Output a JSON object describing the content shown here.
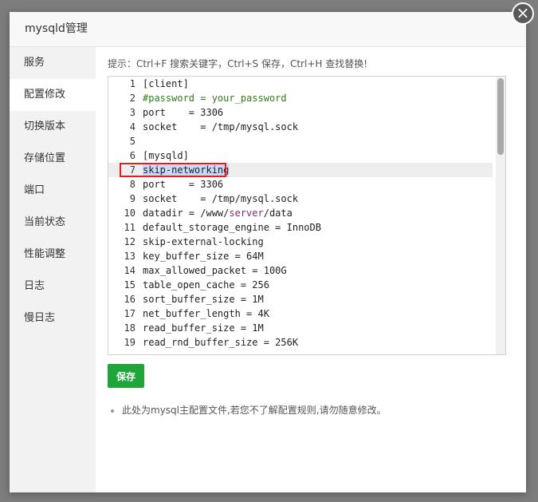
{
  "dialog": {
    "title": "mysqld管理",
    "close_label": "×"
  },
  "sidebar": {
    "items": [
      {
        "label": "服务"
      },
      {
        "label": "配置修改",
        "active": true
      },
      {
        "label": "切换版本"
      },
      {
        "label": "存储位置"
      },
      {
        "label": "端口"
      },
      {
        "label": "当前状态"
      },
      {
        "label": "性能调整"
      },
      {
        "label": "日志"
      },
      {
        "label": "慢日志"
      }
    ]
  },
  "editor": {
    "tip": "提示：Ctrl+F 搜索关键字，Ctrl+S 保存，Ctrl+H 查找替换!",
    "lines": [
      {
        "n": "1",
        "text": "[client]"
      },
      {
        "n": "2",
        "text": "#password = your_password"
      },
      {
        "n": "3",
        "text": "port    = 3306"
      },
      {
        "n": "4",
        "text": "socket    = /tmp/mysql.sock"
      },
      {
        "n": "5",
        "text": ""
      },
      {
        "n": "6",
        "text": "[mysqld]"
      },
      {
        "n": "7",
        "text": "skip-networking"
      },
      {
        "n": "8",
        "text": "port    = 3306"
      },
      {
        "n": "9",
        "text": "socket    = /tmp/mysql.sock"
      },
      {
        "n": "10",
        "text": "datadir = /www/server/data"
      },
      {
        "n": "11",
        "text": "default_storage_engine = InnoDB"
      },
      {
        "n": "12",
        "text": "skip-external-locking"
      },
      {
        "n": "13",
        "text": "key_buffer_size = 64M"
      },
      {
        "n": "14",
        "text": "max_allowed_packet = 100G"
      },
      {
        "n": "15",
        "text": "table_open_cache = 256"
      },
      {
        "n": "16",
        "text": "sort_buffer_size = 1M"
      },
      {
        "n": "17",
        "text": "net_buffer_length = 4K"
      },
      {
        "n": "18",
        "text": "read_buffer_size = 1M"
      },
      {
        "n": "19",
        "text": "read_rnd_buffer_size = 256K"
      }
    ]
  },
  "actions": {
    "save_label": "保存"
  },
  "note": "此处为mysql主配置文件,若您不了解配置规则,请勿随意修改。",
  "colors": {
    "save": "#20a53a",
    "highlight_box": "#e02020",
    "comment": "#2e7d1a"
  }
}
